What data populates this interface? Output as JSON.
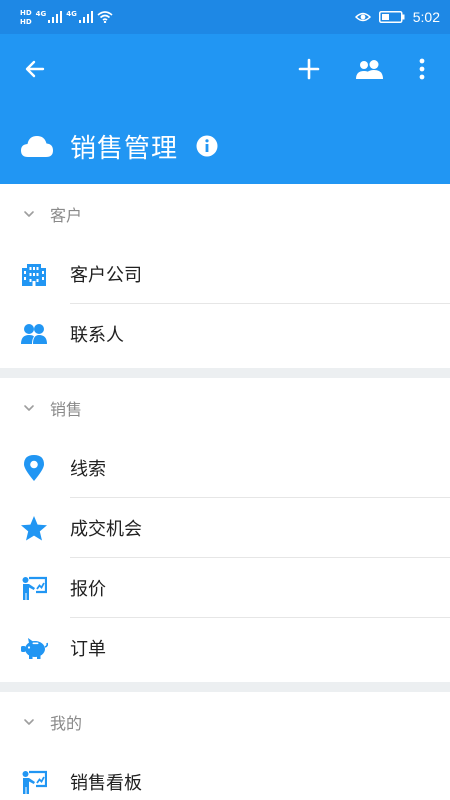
{
  "status_bar": {
    "hd1": "HD",
    "hd2": "HD",
    "net1": "4G",
    "net2": "4G",
    "time": "5:02"
  },
  "app_bar": {
    "title": "销售管理"
  },
  "sections": [
    {
      "title": "客户",
      "items": [
        {
          "label": "客户公司",
          "icon": "building-icon"
        },
        {
          "label": "联系人",
          "icon": "contacts-icon"
        }
      ]
    },
    {
      "title": "销售",
      "items": [
        {
          "label": "线索",
          "icon": "location-pin-icon"
        },
        {
          "label": "成交机会",
          "icon": "star-icon"
        },
        {
          "label": "报价",
          "icon": "presentation-icon"
        },
        {
          "label": "订单",
          "icon": "piggy-bank-icon"
        }
      ]
    },
    {
      "title": "我的",
      "items": [
        {
          "label": "销售看板",
          "icon": "presentation-icon"
        }
      ]
    }
  ],
  "colors": {
    "app_bar": "#2196f3",
    "status_bar": "#1e88e5",
    "icon_accent": "#2196f3",
    "divider": "#e6e6e6",
    "section_gap": "#eceff1"
  }
}
